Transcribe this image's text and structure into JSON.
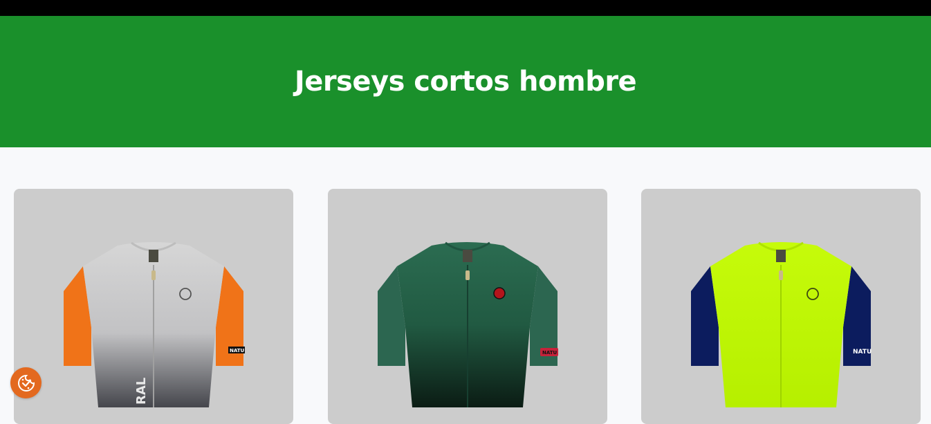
{
  "header": {
    "title": "Jerseys cortos hombre"
  },
  "colors": {
    "top_bar": "#000000",
    "hero": "#1a902b",
    "page_bg": "#f8f9fb",
    "card_bg": "#cccccc",
    "cookie_button": "#e3691f"
  },
  "products": [
    {
      "image": "jersey-gray-orange-sleeves",
      "body_color": "#d4d4d4",
      "body_bottom": "#4a4a50",
      "sleeve_color": "#f07318",
      "sleeve_label": "NATU",
      "chest_text": "RAL"
    },
    {
      "image": "jersey-dark-green",
      "body_color": "#2a6a4f",
      "body_bottom": "#0c1f16",
      "sleeve_color": "#2c6650",
      "sleeve_label": "NATU"
    },
    {
      "image": "jersey-neon-yellow-navy-sleeves",
      "body_color": "#c4fb00",
      "body_bottom": "#b8f000",
      "sleeve_color": "#0c1c5e",
      "sleeve_label": "NATU"
    }
  ],
  "cookie_button": {
    "icon": "cookie-consent-icon"
  }
}
